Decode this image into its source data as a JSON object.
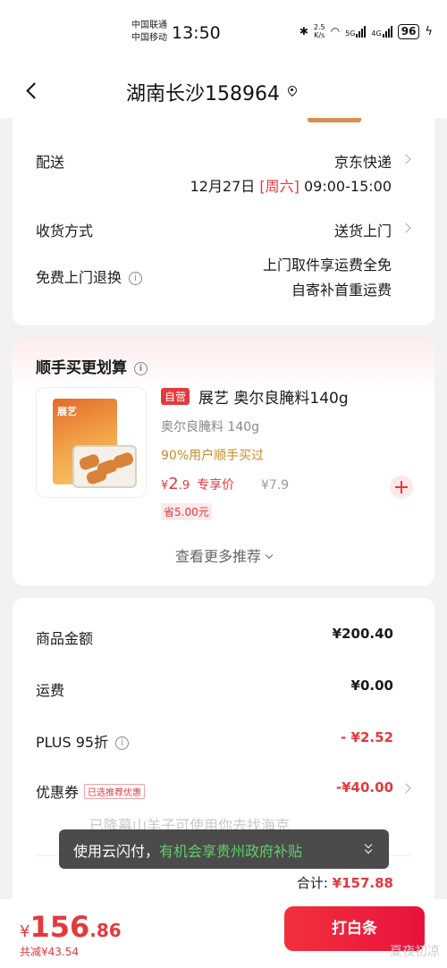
{
  "status_bar": {
    "carrier_1": "中国联通",
    "carrier_2": "中国移动",
    "time": "13:50",
    "net_speed_value": "2.5",
    "net_speed_unit": "K/s",
    "sig1_label": "5G",
    "sig2_label": "4G",
    "battery": "96"
  },
  "nav": {
    "title": "湖南长沙158964"
  },
  "delivery": {
    "shipping_label": "配送",
    "shipping_value": "京东快递",
    "date": "12月27日",
    "weekday": "[周六]",
    "time_window": "09:00-15:00",
    "receive_label": "收货方式",
    "receive_value": "送货上门",
    "return_label": "免费上门退换",
    "return_line1": "上门取件享运费全免",
    "return_line2": "自寄补首重运费"
  },
  "addon": {
    "title": "顺手买更划算",
    "pack_brand": "展艺",
    "badge": "自营",
    "name": "展艺 奥尔良腌料140g",
    "spec": "奥尔良腌料 140g",
    "tip": "90%用户顺手买过",
    "price_symbol": "¥",
    "price_int": "2",
    "price_dec": ".9",
    "price_label": "专享价",
    "original_price": "¥7.9",
    "save": "省5.00元",
    "more": "查看更多推荐"
  },
  "summary": {
    "goods_label": "商品金额",
    "goods_value": "¥200.40",
    "freight_label": "运费",
    "freight_value": "¥0.00",
    "plus_label": "PLUS 95折",
    "plus_value": "- ¥2.52",
    "coupon_label": "优惠券",
    "coupon_tag": "已选推荐优惠",
    "coupon_value": "-¥40.00",
    "total_label": "合计:",
    "total_value": "¥157.88"
  },
  "toast": {
    "prefix": "使用云闪付，",
    "highlight": "有机会享贵州政府补贴",
    "ghost": "已降幕山羊子可使用你去找海克"
  },
  "bottom": {
    "currency": "¥",
    "int": "156",
    "dec": ".86",
    "saved": "共减¥43.54",
    "pay_button": "打白条",
    "watermark": "夏夜初凉"
  },
  "colors": {
    "accent": "#e4393c",
    "toast_highlight": "#5fd068",
    "tip": "#c98a2b"
  }
}
